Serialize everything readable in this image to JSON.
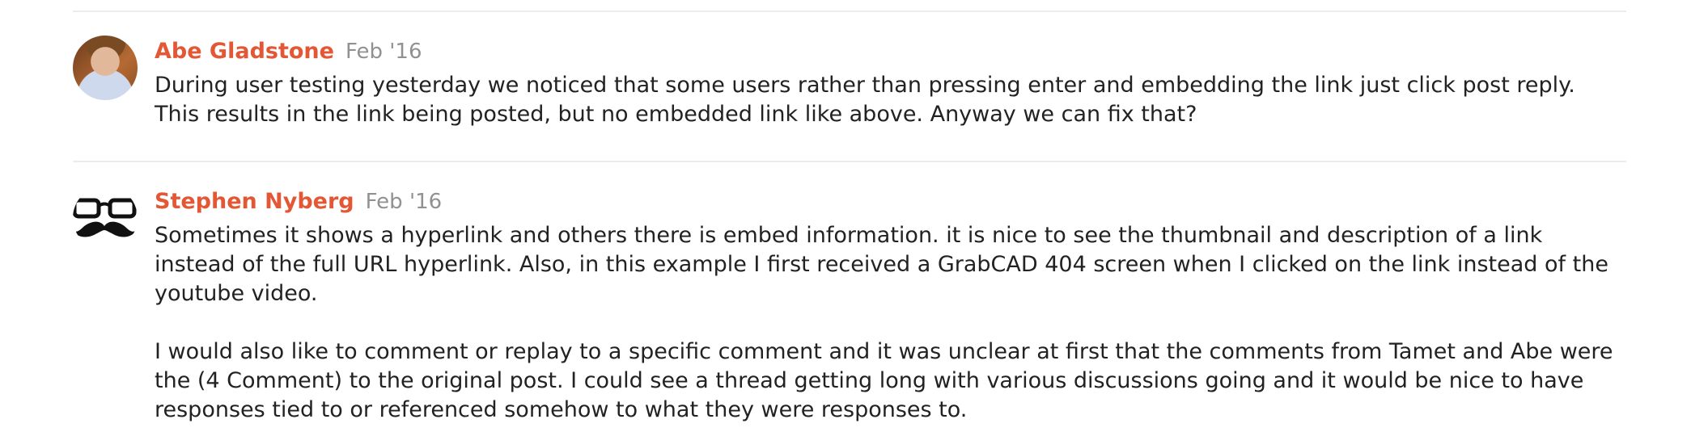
{
  "posts": [
    {
      "username": "Abe Gladstone",
      "date": "Feb '16",
      "avatar_icon": "user-photo-avatar",
      "paragraphs": [
        "During user testing yesterday we noticed that some users rather than pressing enter and embedding the link just click post reply. This results in the link being posted, but no embedded link like above. Anyway we can fix that?"
      ]
    },
    {
      "username": "Stephen Nyberg",
      "date": "Feb '16",
      "avatar_icon": "glasses-mustache-avatar",
      "paragraphs": [
        "Sometimes it shows a hyperlink and others there is embed information. it is nice to see the thumbnail and description of a link instead of the full URL hyperlink. Also, in this example I first received a GrabCAD 404 screen when I clicked on the link instead of the youtube video.",
        "I would also like to comment or replay to a specific comment and it was unclear at first that the comments from Tamet and Abe were the (4 Comment) to the original post. I could see a thread getting long with various discussions going and it would be nice to have responses tied to or referenced somehow to what they were responses to."
      ]
    }
  ],
  "colors": {
    "username": "#e45735",
    "date": "#919191",
    "text": "#222222",
    "divider": "#ececec"
  }
}
